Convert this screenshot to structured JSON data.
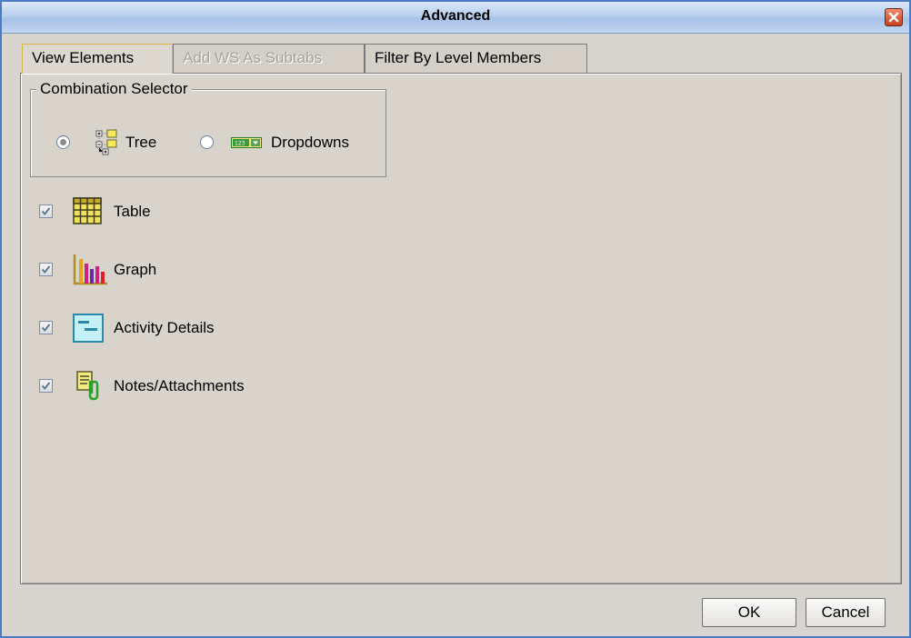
{
  "window": {
    "title": "Advanced"
  },
  "tabs": [
    {
      "label": "View Elements",
      "state": "active"
    },
    {
      "label": "Add WS As Subtabs",
      "state": "disabled"
    },
    {
      "label": "Filter By Level Members",
      "state": "normal"
    }
  ],
  "combination_selector": {
    "legend": "Combination Selector",
    "options": [
      {
        "label": "Tree",
        "icon": "tree-icon",
        "checked": true
      },
      {
        "label": "Dropdowns",
        "icon": "dropdown-icon",
        "checked": false
      }
    ]
  },
  "elements": [
    {
      "label": "Table",
      "icon": "table-icon",
      "checked": true
    },
    {
      "label": "Graph",
      "icon": "bar-chart-icon",
      "checked": true
    },
    {
      "label": "Activity Details",
      "icon": "activity-details-icon",
      "checked": true
    },
    {
      "label": "Notes/Attachments",
      "icon": "notes-attachment-icon",
      "checked": true
    }
  ],
  "buttons": {
    "ok": "OK",
    "cancel": "Cancel"
  },
  "colors": {
    "title_bar": "#b8cfee",
    "dialog_bg": "#d8d5d0",
    "active_tab_border": "#d9b54a",
    "disabled_text": "#a6a39c"
  }
}
